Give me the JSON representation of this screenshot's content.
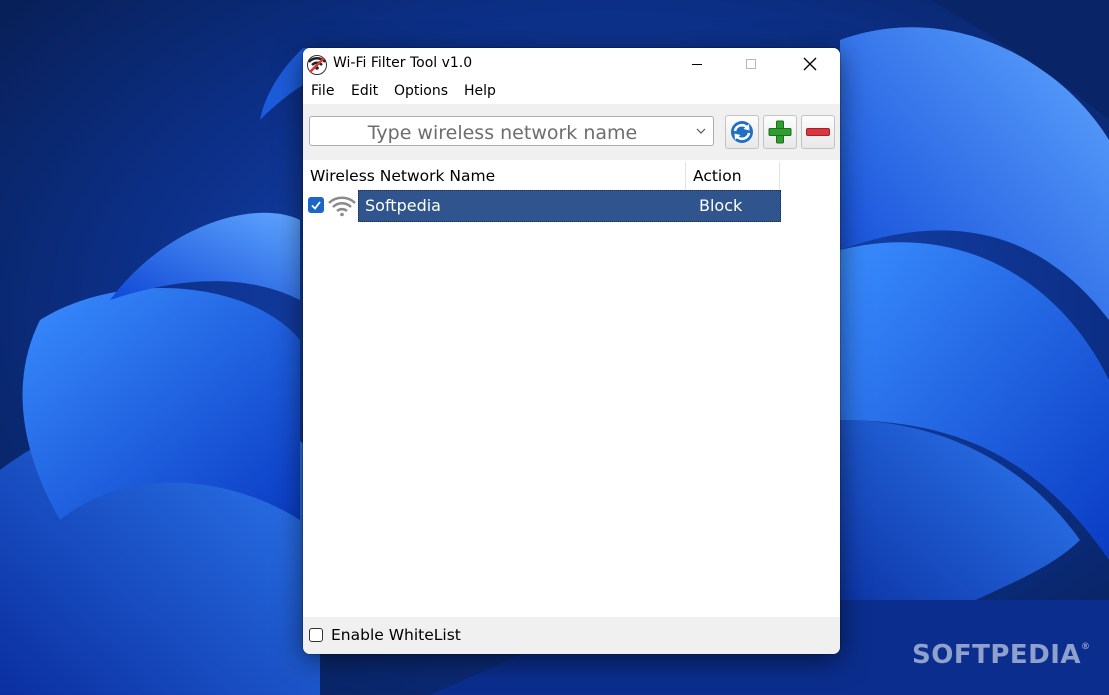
{
  "window": {
    "title": "Wi-Fi Filter Tool v1.0"
  },
  "menu": {
    "items": [
      "File",
      "Edit",
      "Options",
      "Help"
    ]
  },
  "toolbar": {
    "network_input_placeholder": "Type wireless network name",
    "buttons": [
      "refresh-icon",
      "add-icon",
      "remove-icon"
    ]
  },
  "list": {
    "columns": [
      "Wireless Network Name",
      "Action"
    ],
    "rows": [
      {
        "name": "Softpedia",
        "action": "Block",
        "checked": true,
        "icon": "wifi-icon"
      }
    ]
  },
  "footer": {
    "whitelist_label": "Enable WhiteList",
    "whitelist_checked": false
  },
  "watermark": "SOFTPEDIA",
  "colors": {
    "selection": "#30548d",
    "checkbox": "#1a66c9",
    "add_green": "#2e9e2e",
    "remove_red": "#d9363e",
    "refresh_blue": "#1f6fc4"
  }
}
